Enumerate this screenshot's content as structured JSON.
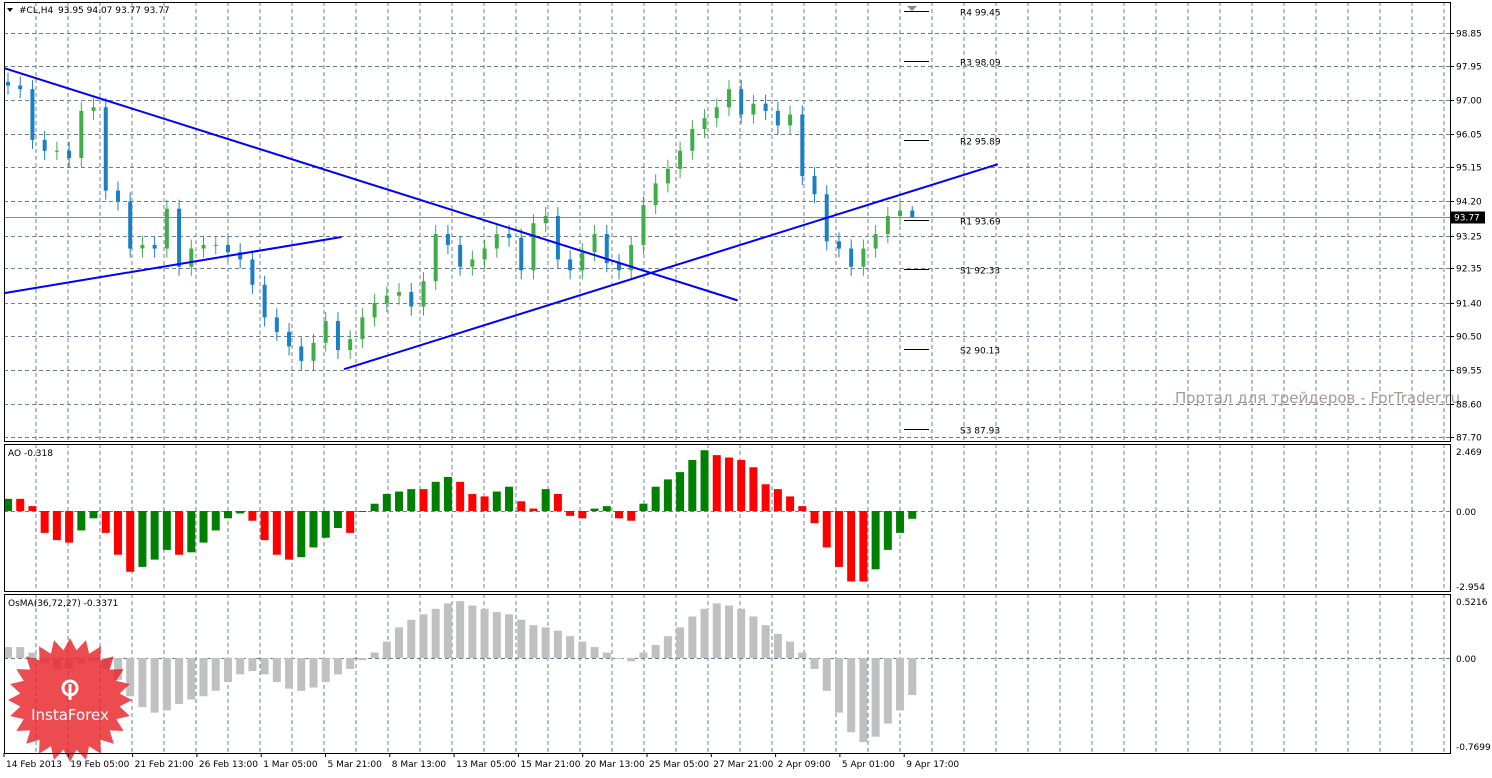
{
  "header": {
    "symbol": "#CL,H4",
    "ohlc": "93.95 94.07 93.77 93.77"
  },
  "watermark": "Портал для трейдеров - ForTrader.ru",
  "logo": {
    "text": "InstaForex",
    "color": "#e8262a"
  },
  "colors": {
    "bull": "#3fae49",
    "bear": "#1b7fc4",
    "trend": "#0000ff",
    "ao_up": "#008000",
    "ao_down": "#ff0000",
    "osma": "#c0c0c0",
    "grid": "#6f7f90"
  },
  "chart_data": [
    {
      "type": "candlestick",
      "title": "#CL,H4",
      "ylim": [
        87.55,
        99.75
      ],
      "yticks": [
        98.85,
        97.95,
        97.0,
        96.05,
        95.15,
        94.2,
        93.25,
        92.35,
        91.4,
        90.5,
        89.55,
        88.6,
        87.7
      ],
      "current_price": 93.77,
      "last_bar": {
        "open": 93.95,
        "high": 94.07,
        "low": 93.77,
        "close": 93.77
      },
      "closes": [
        97.4,
        97.3,
        95.9,
        95.6,
        95.6,
        95.4,
        96.7,
        96.8,
        94.5,
        94.2,
        92.9,
        93.0,
        92.9,
        94.0,
        92.4,
        92.9,
        93.0,
        93.0,
        92.8,
        92.6,
        91.9,
        91.0,
        90.6,
        90.2,
        89.8,
        90.3,
        90.9,
        90.1,
        90.4,
        91.0,
        91.4,
        91.6,
        91.7,
        91.3,
        92.0,
        93.3,
        93.0,
        92.4,
        92.6,
        92.9,
        93.3,
        93.2,
        92.3,
        93.6,
        93.8,
        92.6,
        92.3,
        92.8,
        93.3,
        92.5,
        92.3,
        93.0,
        94.1,
        94.7,
        95.1,
        95.6,
        96.2,
        96.5,
        96.8,
        97.3,
        96.6,
        96.9,
        96.7,
        96.3,
        96.6,
        94.9,
        94.4,
        93.1,
        92.9,
        92.4,
        92.9,
        93.3,
        93.8,
        93.95,
        93.77
      ],
      "trendlines": [
        {
          "from": [
            -0.3,
            97.88
          ],
          "to": [
            59.7,
            91.47
          ]
        },
        {
          "from": [
            -0.3,
            91.67
          ],
          "to": [
            27.3,
            93.22
          ]
        },
        {
          "from": [
            27.5,
            89.57
          ],
          "to": [
            81.0,
            95.23
          ]
        }
      ],
      "pivots": [
        {
          "label": "R4 99.45",
          "value": 99.45
        },
        {
          "label": "R3 98.09",
          "value": 98.09
        },
        {
          "label": "R2 95.89",
          "value": 95.89
        },
        {
          "label": "R1 93.69",
          "value": 93.69
        },
        {
          "label": "S1 92.33",
          "value": 92.33
        },
        {
          "label": "S2 90.13",
          "value": 90.13
        },
        {
          "label": "S3 87.93",
          "value": 87.93
        }
      ],
      "xticks": [
        "14 Feb 2013",
        "19 Feb 05:00",
        "21 Feb 21:00",
        "26 Feb 13:00",
        "1 Mar 05:00",
        "5 Mar 21:00",
        "8 Mar 13:00",
        "13 Mar 05:00",
        "15 Mar 21:00",
        "20 Mar 13:00",
        "25 Mar 05:00",
        "27 Mar 21:00",
        "2 Apr 09:00",
        "5 Apr 01:00",
        "9 Apr 17:00"
      ]
    },
    {
      "type": "bar",
      "title": "AO -0.318",
      "ylim": [
        -2.954,
        2.469
      ],
      "yticks": [
        "2.469",
        "0.00",
        "-2.954"
      ],
      "values": [
        0.5,
        0.5,
        0.2,
        -0.9,
        -1.2,
        -1.3,
        -0.8,
        -0.3,
        -0.9,
        -1.8,
        -2.5,
        -2.3,
        -2.0,
        -1.6,
        -1.8,
        -1.7,
        -1.3,
        -0.8,
        -0.3,
        -0.1,
        -0.4,
        -1.2,
        -1.8,
        -2.0,
        -1.9,
        -1.5,
        -1.1,
        -0.7,
        -0.9,
        0.0,
        0.3,
        0.7,
        0.8,
        0.9,
        0.9,
        1.2,
        1.4,
        1.2,
        0.7,
        0.6,
        0.8,
        1.0,
        0.4,
        0.1,
        0.9,
        0.7,
        -0.2,
        -0.3,
        0.1,
        0.2,
        -0.3,
        -0.4,
        0.3,
        1.0,
        1.3,
        1.6,
        2.1,
        2.5,
        2.3,
        2.2,
        2.1,
        1.8,
        1.1,
        0.9,
        0.6,
        0.2,
        -0.5,
        -1.5,
        -2.3,
        -2.9,
        -2.9,
        -2.4,
        -1.6,
        -0.9,
        -0.32
      ]
    },
    {
      "type": "bar",
      "title": "OsMA(36,72,27) -0.3371",
      "ylim": [
        -0.7699,
        0.5216
      ],
      "yticks": [
        "0.5216",
        "0.00",
        "-0.7699"
      ],
      "values": [
        0.1,
        0.1,
        0.05,
        -0.05,
        -0.1,
        -0.1,
        -0.05,
        -0.03,
        -0.1,
        -0.2,
        -0.35,
        -0.45,
        -0.5,
        -0.48,
        -0.42,
        -0.38,
        -0.35,
        -0.3,
        -0.22,
        -0.15,
        -0.12,
        -0.15,
        -0.22,
        -0.28,
        -0.3,
        -0.27,
        -0.22,
        -0.15,
        -0.1,
        -0.02,
        0.05,
        0.15,
        0.28,
        0.35,
        0.4,
        0.45,
        0.5,
        0.52,
        0.48,
        0.45,
        0.42,
        0.4,
        0.35,
        0.3,
        0.28,
        0.25,
        0.2,
        0.15,
        0.1,
        0.05,
        0.0,
        -0.03,
        0.05,
        0.12,
        0.2,
        0.28,
        0.38,
        0.45,
        0.5,
        0.48,
        0.45,
        0.38,
        0.3,
        0.22,
        0.15,
        0.05,
        -0.1,
        -0.3,
        -0.5,
        -0.68,
        -0.77,
        -0.72,
        -0.6,
        -0.48,
        -0.34
      ]
    }
  ]
}
